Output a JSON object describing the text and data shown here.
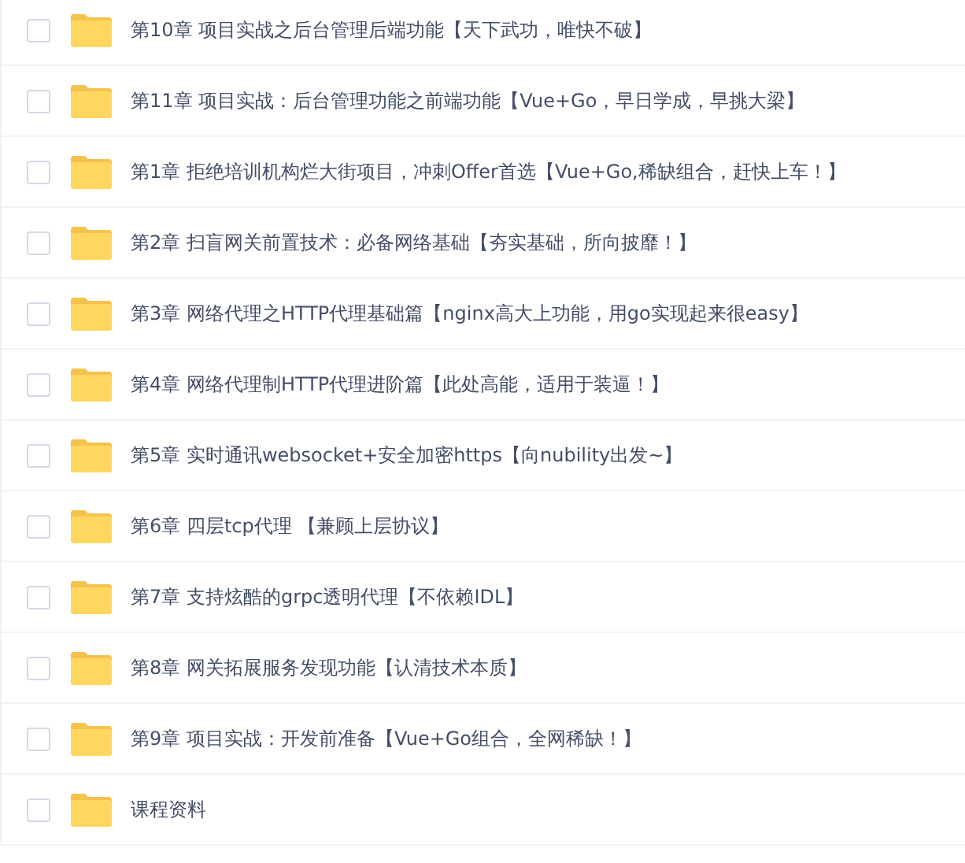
{
  "files": [
    {
      "name": "第10章 项目实战之后台管理后端功能【天下武功，唯快不破】",
      "checked": false
    },
    {
      "name": "第11章 项目实战：后台管理功能之前端功能【Vue+Go，早日学成，早挑大梁】",
      "checked": false
    },
    {
      "name": "第1章 拒绝培训机构烂大街项目，冲刺Offer首选【Vue+Go,稀缺组合，赶快上车！】",
      "checked": false
    },
    {
      "name": "第2章 扫盲网关前置技术：必备网络基础【夯实基础，所向披靡！】",
      "checked": false
    },
    {
      "name": "第3章 网络代理之HTTP代理基础篇【nginx高大上功能，用go实现起来很easy】",
      "checked": false
    },
    {
      "name": "第4章 网络代理制HTTP代理进阶篇【此处高能，适用于装逼！】",
      "checked": false
    },
    {
      "name": "第5章 实时通讯websocket+安全加密https【向nubility出发~】",
      "checked": false
    },
    {
      "name": "第6章 四层tcp代理 【兼顾上层协议】",
      "checked": false
    },
    {
      "name": "第7章 支持炫酷的grpc透明代理【不依赖IDL】",
      "checked": false
    },
    {
      "name": "第8章 网关拓展服务发现功能【认清技术本质】",
      "checked": false
    },
    {
      "name": "第9章 项目实战：开发前准备【Vue+Go组合，全网稀缺！】",
      "checked": false
    },
    {
      "name": "课程资料",
      "checked": false
    }
  ]
}
